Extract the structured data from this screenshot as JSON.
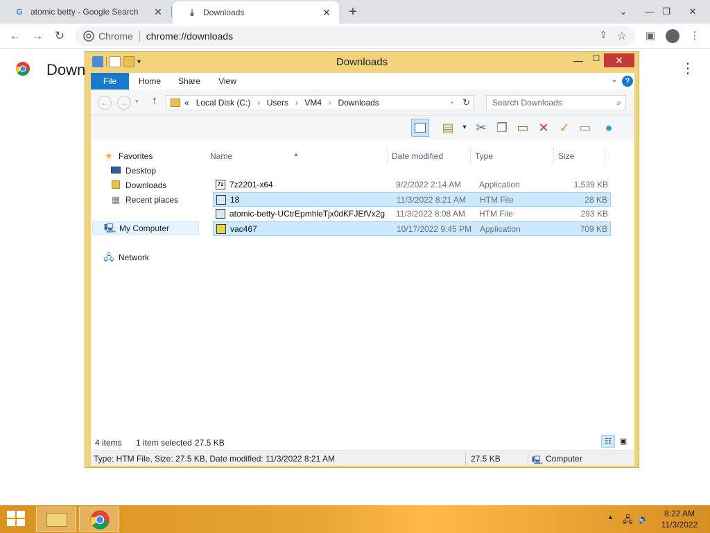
{
  "browser": {
    "tabs": [
      {
        "label": "atomic betty - Google Search",
        "icon": "google-g-icon"
      },
      {
        "label": "Downloads",
        "icon": "download-icon"
      }
    ],
    "omnibox": {
      "site": "Chrome",
      "url": "chrome://downloads"
    },
    "page_title": "Downloads"
  },
  "explorer": {
    "title": "Downloads",
    "ribbon_tabs": [
      "File",
      "Home",
      "Share",
      "View"
    ],
    "address": {
      "prefix": "«",
      "crumbs": [
        "Local Disk (C:)",
        "Users",
        "VM4",
        "Downloads"
      ]
    },
    "search_placeholder": "Search Downloads",
    "nav": {
      "favorites": "Favorites",
      "desktop": "Desktop",
      "downloads": "Downloads",
      "recent": "Recent places",
      "computer": "My Computer",
      "network": "Network"
    },
    "columns": {
      "name": "Name",
      "date": "Date modified",
      "type": "Type",
      "size": "Size"
    },
    "files": [
      {
        "name": "7z2201-x64",
        "date": "9/2/2022 2:14 AM",
        "type": "Application",
        "size": "1,539 KB"
      },
      {
        "name": "18",
        "date": "11/3/2022 8:21 AM",
        "type": "HTM File",
        "size": "28 KB"
      },
      {
        "name": "atomic-betty-UCtrEpmhleTjx0dKFJEfVx2g",
        "date": "11/3/2022 8:08 AM",
        "type": "HTM File",
        "size": "293 KB"
      },
      {
        "name": "vac467",
        "date": "10/17/2022 9:45 PM",
        "type": "Application",
        "size": "709 KB"
      }
    ],
    "status": {
      "count": "4 items",
      "selected": "1 item selected",
      "sel_size": "27.5 KB"
    },
    "details": {
      "info": "Type: HTM File, Size: 27.5 KB, Date modified: 11/3/2022 8:21 AM",
      "size": "27.5 KB",
      "location": "Computer"
    }
  },
  "taskbar": {
    "time": "8:22 AM",
    "date": "11/3/2022"
  },
  "colors": {
    "explorer_frame": "#f2d27a",
    "close_red": "#c7383a",
    "file_tab_blue": "#1979ca",
    "selection": "#cce8ff",
    "taskbar": "#e8a535"
  }
}
